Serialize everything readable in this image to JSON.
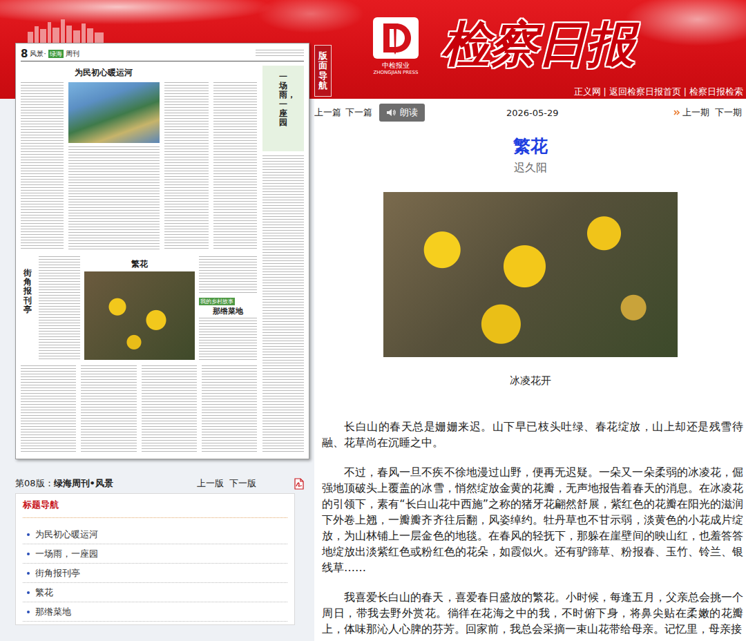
{
  "masthead": {
    "logo_cn": "中检报业",
    "logo_en": "ZHONGJIAN PRESS",
    "title": "检察日报",
    "links": [
      "正义网",
      "返回检察日报首页",
      "检察日报检索"
    ],
    "separator": "|"
  },
  "layout_tab": "版面导航",
  "page_thumbnail": {
    "page_no": "8",
    "section": "风景·",
    "badge": "绿海",
    "label": "周刊",
    "lead_title": "为民初心暖运河",
    "side_title": "一场雨，一座园",
    "column_title": "街角报刊亭",
    "feature_title": "繁花",
    "series_label": "我的乡村故事",
    "story_title": "那绺菜地"
  },
  "page_info": {
    "prefix": "第08版：",
    "name": "绿海周刊•风景",
    "prev": "上一版",
    "next": "下一版"
  },
  "title_nav": {
    "title": "标题导航",
    "items": [
      "为民初心暖运河",
      "一场雨，一座园",
      "街角报刊亭",
      "繁花",
      "那绺菜地"
    ]
  },
  "toolbar": {
    "prev_article": "上一篇",
    "next_article": "下一篇",
    "read_aloud": "朗读",
    "date": "2026-05-29",
    "prev_issue": "上一期",
    "next_issue": "下一期"
  },
  "article": {
    "title": "繁花",
    "author": "迟久阳",
    "caption": "冰凌花开",
    "paragraphs": [
      "长白山的春天总是姗姗来迟。山下早已枝头吐绿、春花绽放，山上却还是残雪待融、花草尚在沉睡之中。",
      "不过，春风一旦不疾不徐地漫过山野，便再无迟疑。一朵又一朵柔弱的冰凌花，倔强地顶破头上覆盖的冰雪，悄然绽放金黄的花瓣，无声地报告着春天的消息。在冰凌花的引领下，素有“长白山花中西施”之称的猪牙花翩然舒展，紫红色的花瓣在阳光的滋润下外卷上翘，一瓣瓣齐齐往后翻，风姿绰约。牡丹草也不甘示弱，淡黄色的小花成片绽放，为山林铺上一层金色的地毯。在春风的轻抚下，那躲在崖壁间的映山红，也羞答答地绽放出淡紫红色或粉红色的花朵，如霞似火。还有驴蹄草、粉报春、玉竹、铃兰、银线草……",
      "我喜爱长白山的春天，喜爱春日盛放的繁花。小时候，每逢五月，父亲总会挑一个周日，带我去野外赏花。徜徉在花海之中的我，不时俯下身，将鼻尖贴在柔嫩的花瓣上，体味那沁人心脾的芬芳。回家前，我总会采摘一束山花带给母亲。记忆里，母亲接"
    ]
  }
}
